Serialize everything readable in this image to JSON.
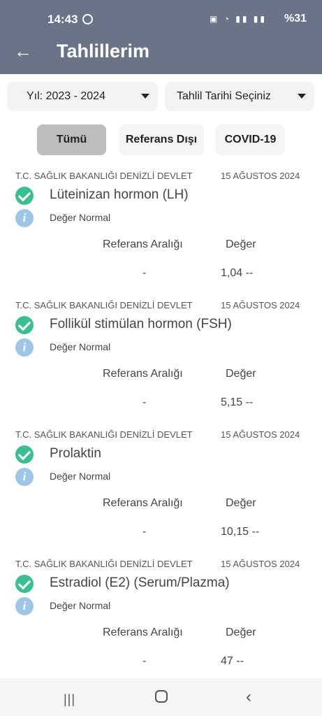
{
  "status_bar": {
    "time": "14:43",
    "battery": "%31"
  },
  "app_bar": {
    "title": "Tahlillerim"
  },
  "filters": {
    "year": "Yıl: 2023 - 2024",
    "date": "Tahlil Tarihi Seçiniz"
  },
  "tabs": [
    {
      "label": "Tümü"
    },
    {
      "label": "Referans Dışı"
    },
    {
      "label": "COVID-19"
    }
  ],
  "results": [
    {
      "institution": "T.C. SAĞLIK BAKANLIĞI DENİZLİ DEVLET",
      "date": "15 AĞUSTOS 2024",
      "name": "Lüteinizan hormon (LH)",
      "status": "Değer Normal",
      "ref_header": "Referans Aralığı",
      "val_header": "Değer",
      "ref_range": "-",
      "value": "1,04 --"
    },
    {
      "institution": "T.C. SAĞLIK BAKANLIĞI DENİZLİ DEVLET",
      "date": "15 AĞUSTOS 2024",
      "name": "Follikül stimülan hormon (FSH)",
      "status": "Değer Normal",
      "ref_header": "Referans Aralığı",
      "val_header": "Değer",
      "ref_range": "-",
      "value": "5,15 --"
    },
    {
      "institution": "T.C. SAĞLIK BAKANLIĞI DENİZLİ DEVLET",
      "date": "15 AĞUSTOS 2024",
      "name": "Prolaktin",
      "status": "Değer Normal",
      "ref_header": "Referans Aralığı",
      "val_header": "Değer",
      "ref_range": "-",
      "value": "10,15 --"
    },
    {
      "institution": "T.C. SAĞLIK BAKANLIĞI DENİZLİ DEVLET",
      "date": "15 AĞUSTOS 2024",
      "name": "Estradiol (E2) (Serum/Plazma)",
      "status": "Değer Normal",
      "ref_header": "Referans Aralığı",
      "val_header": "Değer",
      "ref_range": "-",
      "value": "47 --"
    }
  ],
  "icons": {
    "back": "back-arrow-icon",
    "dropdown": "caret-down-icon",
    "check": "check-circle-icon",
    "info": "info-icon",
    "nav_recent": "recent-apps-icon",
    "nav_home": "home-icon",
    "nav_back": "nav-back-icon"
  },
  "colors": {
    "header": "#6b7389",
    "check": "#3cbf8f",
    "info": "#9ec6e6",
    "selected_tab": "#bdbdbd"
  }
}
